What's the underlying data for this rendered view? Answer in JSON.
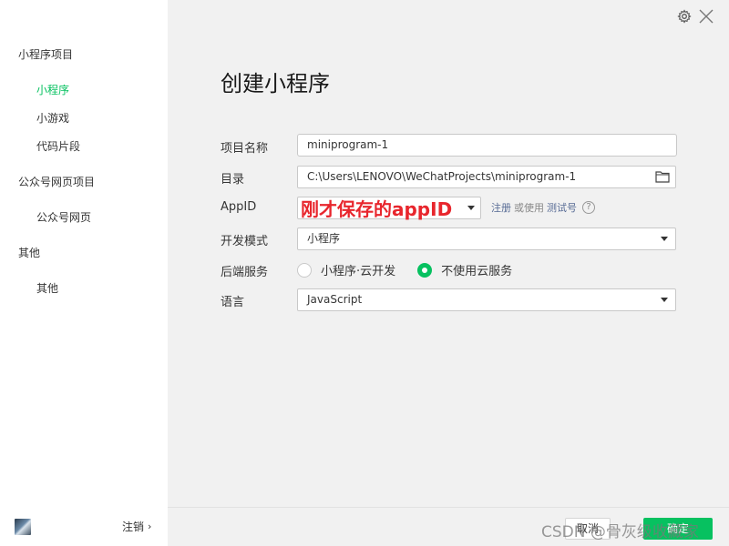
{
  "sidebar": {
    "groups": [
      {
        "label": "小程序项目",
        "items": [
          "小程序",
          "小游戏",
          "代码片段"
        ]
      },
      {
        "label": "公众号网页项目",
        "items": [
          "公众号网页"
        ]
      },
      {
        "label": "其他",
        "items": [
          "其他"
        ]
      }
    ],
    "active_item": "小程序",
    "logout_label": "注销"
  },
  "main": {
    "title": "创建小程序",
    "fields": {
      "project_name": {
        "label": "项目名称",
        "value": "miniprogram-1"
      },
      "directory": {
        "label": "目录",
        "value": "C:\\Users\\LENOVO\\WeChatProjects\\miniprogram-1"
      },
      "appid": {
        "label": "AppID",
        "overlay_text": "刚才保存的appID",
        "register_link": "注册",
        "or_use": "或使用",
        "test_link": "测试号",
        "help": "?"
      },
      "dev_mode": {
        "label": "开发模式",
        "value": "小程序"
      },
      "backend": {
        "label": "后端服务",
        "options": [
          "小程序·云开发",
          "不使用云服务"
        ],
        "selected": "不使用云服务"
      },
      "language": {
        "label": "语言",
        "value": "JavaScript"
      }
    }
  },
  "footer": {
    "cancel_label": "取消",
    "create_label": "确定",
    "watermark": "CSDN @骨灰级收藏家"
  },
  "colors": {
    "accent": "#07c160",
    "annotation": "#e8262d",
    "link": "#576b95"
  },
  "icons": [
    "gear-icon",
    "close-icon",
    "folder-icon",
    "chevron-right-icon",
    "chevron-down-icon",
    "help-icon"
  ]
}
